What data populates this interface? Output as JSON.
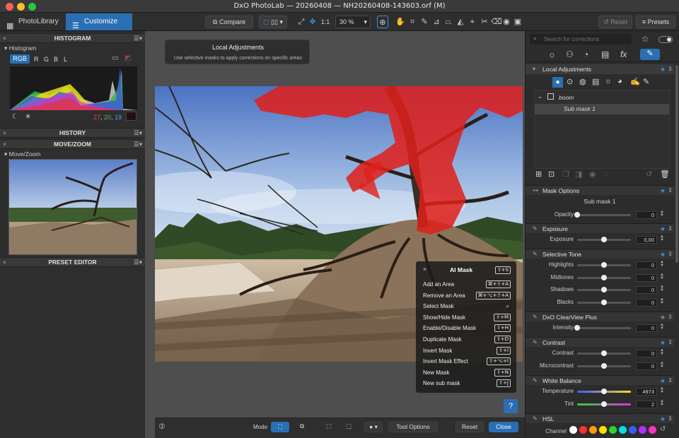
{
  "window": {
    "title": "DxO PhotoLab — 20260408 — NH20260408-143603.orf (M)"
  },
  "tabs": [
    {
      "label": "PhotoLibrary",
      "icon": "grid-icon"
    },
    {
      "label": "Customize",
      "icon": "sliders-icon"
    }
  ],
  "toolbar": {
    "compare_label": "Compare",
    "zoom": "30 %",
    "fit_label": "1:1",
    "reset_label": "Reset",
    "presets_label": "Presets"
  },
  "left": {
    "histogram": {
      "title": "HISTOGRAM",
      "sub": "Histogram",
      "channels": [
        "RGB",
        "R",
        "G",
        "B",
        "L"
      ],
      "active_channel": "RGB",
      "r": "27",
      "g": "20",
      "b": "19"
    },
    "history": {
      "title": "HISTORY"
    },
    "movezoom": {
      "title": "MOVE/ZOOM",
      "sub": "Move/Zoom"
    },
    "preset": {
      "title": "PRESET EDITOR"
    }
  },
  "tooltip": {
    "title": "Local Adjustments",
    "text": "Use selective masks to apply corrections on specific areas"
  },
  "context_menu": {
    "title": "AI Mask",
    "title_shortcut": "⇧+S",
    "items": [
      {
        "label": "Add an Area",
        "shortcut": "⌘+⇧+A"
      },
      {
        "label": "Remove an Area",
        "shortcut": "⌘+⌥+⇧+A"
      },
      {
        "label": "Select Mask",
        "shortcut": ""
      },
      {
        "label": "Show/Hide Mask",
        "shortcut": "⇧+M"
      },
      {
        "label": "Enable/Disable Mask",
        "shortcut": "⇧+H"
      },
      {
        "label": "Duplicate Mask",
        "shortcut": "⇧+D"
      },
      {
        "label": "Invert Mask",
        "shortcut": "⇧+I"
      },
      {
        "label": "Invert Mask Effect",
        "shortcut": "⇧+⌥+I"
      },
      {
        "label": "New Mask",
        "shortcut": "⇧+N"
      },
      {
        "label": "New sub mask",
        "shortcut": "⇧+J"
      }
    ]
  },
  "bottom": {
    "mode_label": "Mode",
    "tool_options_label": "Tool Options",
    "reset_label": "Reset",
    "close_label": "Close",
    "help_label": "?"
  },
  "right": {
    "search_placeholder": "Search for corrections",
    "local_adjustments_title": "Local Adjustments",
    "mask_list": [
      {
        "label": "boom"
      },
      {
        "label": "Sub mask 1"
      }
    ],
    "mask_options": {
      "title": "Mask Options",
      "name": "Sub mask 1",
      "opacity_label": "Opacity",
      "opacity": "0"
    },
    "exposure": {
      "title": "Exposure",
      "label": "Exposure",
      "value": "0,00"
    },
    "selective_tone": {
      "title": "Selective Tone",
      "sliders": [
        {
          "label": "Highlights",
          "value": "0"
        },
        {
          "label": "Midtones",
          "value": "0"
        },
        {
          "label": "Shadows",
          "value": "0"
        },
        {
          "label": "Blacks",
          "value": "0"
        }
      ]
    },
    "clearview": {
      "title": "DxO ClearView Plus",
      "label": "Intensity",
      "value": "0"
    },
    "contrast": {
      "title": "Contrast",
      "sliders": [
        {
          "label": "Contrast",
          "value": "0"
        },
        {
          "label": "Microcontrast",
          "value": "0"
        }
      ]
    },
    "white_balance": {
      "title": "White Balance",
      "sliders": [
        {
          "label": "Temperature",
          "value": "4973"
        },
        {
          "label": "Tint",
          "value": "2"
        }
      ]
    },
    "hsl": {
      "title": "HSL",
      "channel_label": "Channel",
      "channel_colors": [
        "#ffffff",
        "#ff3030",
        "#ff9a00",
        "#ffe000",
        "#30d030",
        "#00e0e0",
        "#3060ff",
        "#b030ff",
        "#ff30c0"
      ]
    }
  },
  "colors": {
    "accent": "#3a8ee6",
    "mask_red": "#e0201a",
    "active_tab": "#2a6fb3"
  }
}
